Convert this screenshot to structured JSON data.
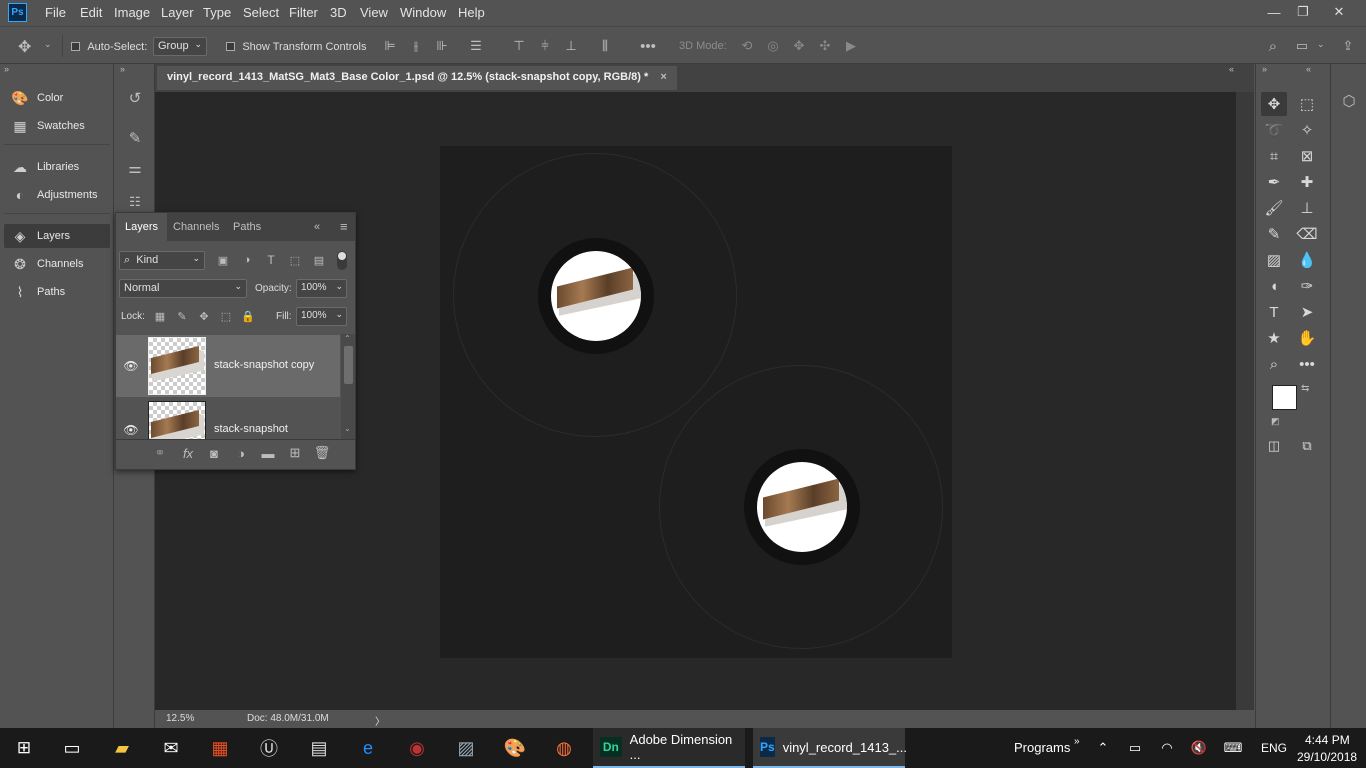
{
  "app": {
    "logo": "Ps"
  },
  "menu": [
    "File",
    "Edit",
    "Image",
    "Layer",
    "Type",
    "Select",
    "Filter",
    "3D",
    "View",
    "Window",
    "Help"
  ],
  "window_controls": {
    "minimize": "—",
    "restore": "❐",
    "close": "✕"
  },
  "options_bar": {
    "auto_select_label": "Auto-Select:",
    "auto_select_target": "Group",
    "show_transform_label": "Show Transform Controls",
    "mode_3d_label": "3D Mode:"
  },
  "dock": {
    "items": [
      "Color",
      "Swatches",
      "Libraries",
      "Adjustments",
      "Layers",
      "Channels",
      "Paths"
    ],
    "active": "Layers"
  },
  "document": {
    "tab_title": "vinyl_record_1413_MatSG_Mat3_Base Color_1.psd @ 12.5% (stack-snapshot copy, RGB/8) *",
    "tab_close": "×",
    "zoom": "12.5%",
    "doc_info": "Doc: 48.0M/31.0M",
    "status_arrow": "〉"
  },
  "layers_panel": {
    "tabs": [
      "Layers",
      "Channels",
      "Paths"
    ],
    "active_tab": "Layers",
    "filter_kind": "Kind",
    "blend_mode": "Normal",
    "opacity_label": "Opacity:",
    "opacity_value": "100%",
    "lock_label": "Lock:",
    "fill_label": "Fill:",
    "fill_value": "100%",
    "layers": [
      {
        "name": "stack-snapshot copy",
        "selected": true,
        "visible": true
      },
      {
        "name": "stack-snapshot",
        "selected": false,
        "visible": true
      }
    ],
    "footer_icons": [
      "link-icon",
      "fx-icon",
      "mask-icon",
      "adjustment-icon",
      "folder-icon",
      "new-layer-icon",
      "trash-icon"
    ],
    "fx_label": "fx"
  },
  "colors": {
    "foreground": "#ffffff",
    "background": "#7a8596",
    "accent": "#31a8ff"
  },
  "taskbar": {
    "apps": [
      {
        "label": "Adobe Dimension ...",
        "logo": "Dn",
        "color": "#2fd89a"
      },
      {
        "label": "vinyl_record_1413_...",
        "logo": "Ps",
        "color": "#31a8ff"
      }
    ],
    "programs_label": "Programs",
    "programs_chevron": "»",
    "lang": "ENG",
    "time": "4:44 PM",
    "date": "29/10/2018"
  }
}
